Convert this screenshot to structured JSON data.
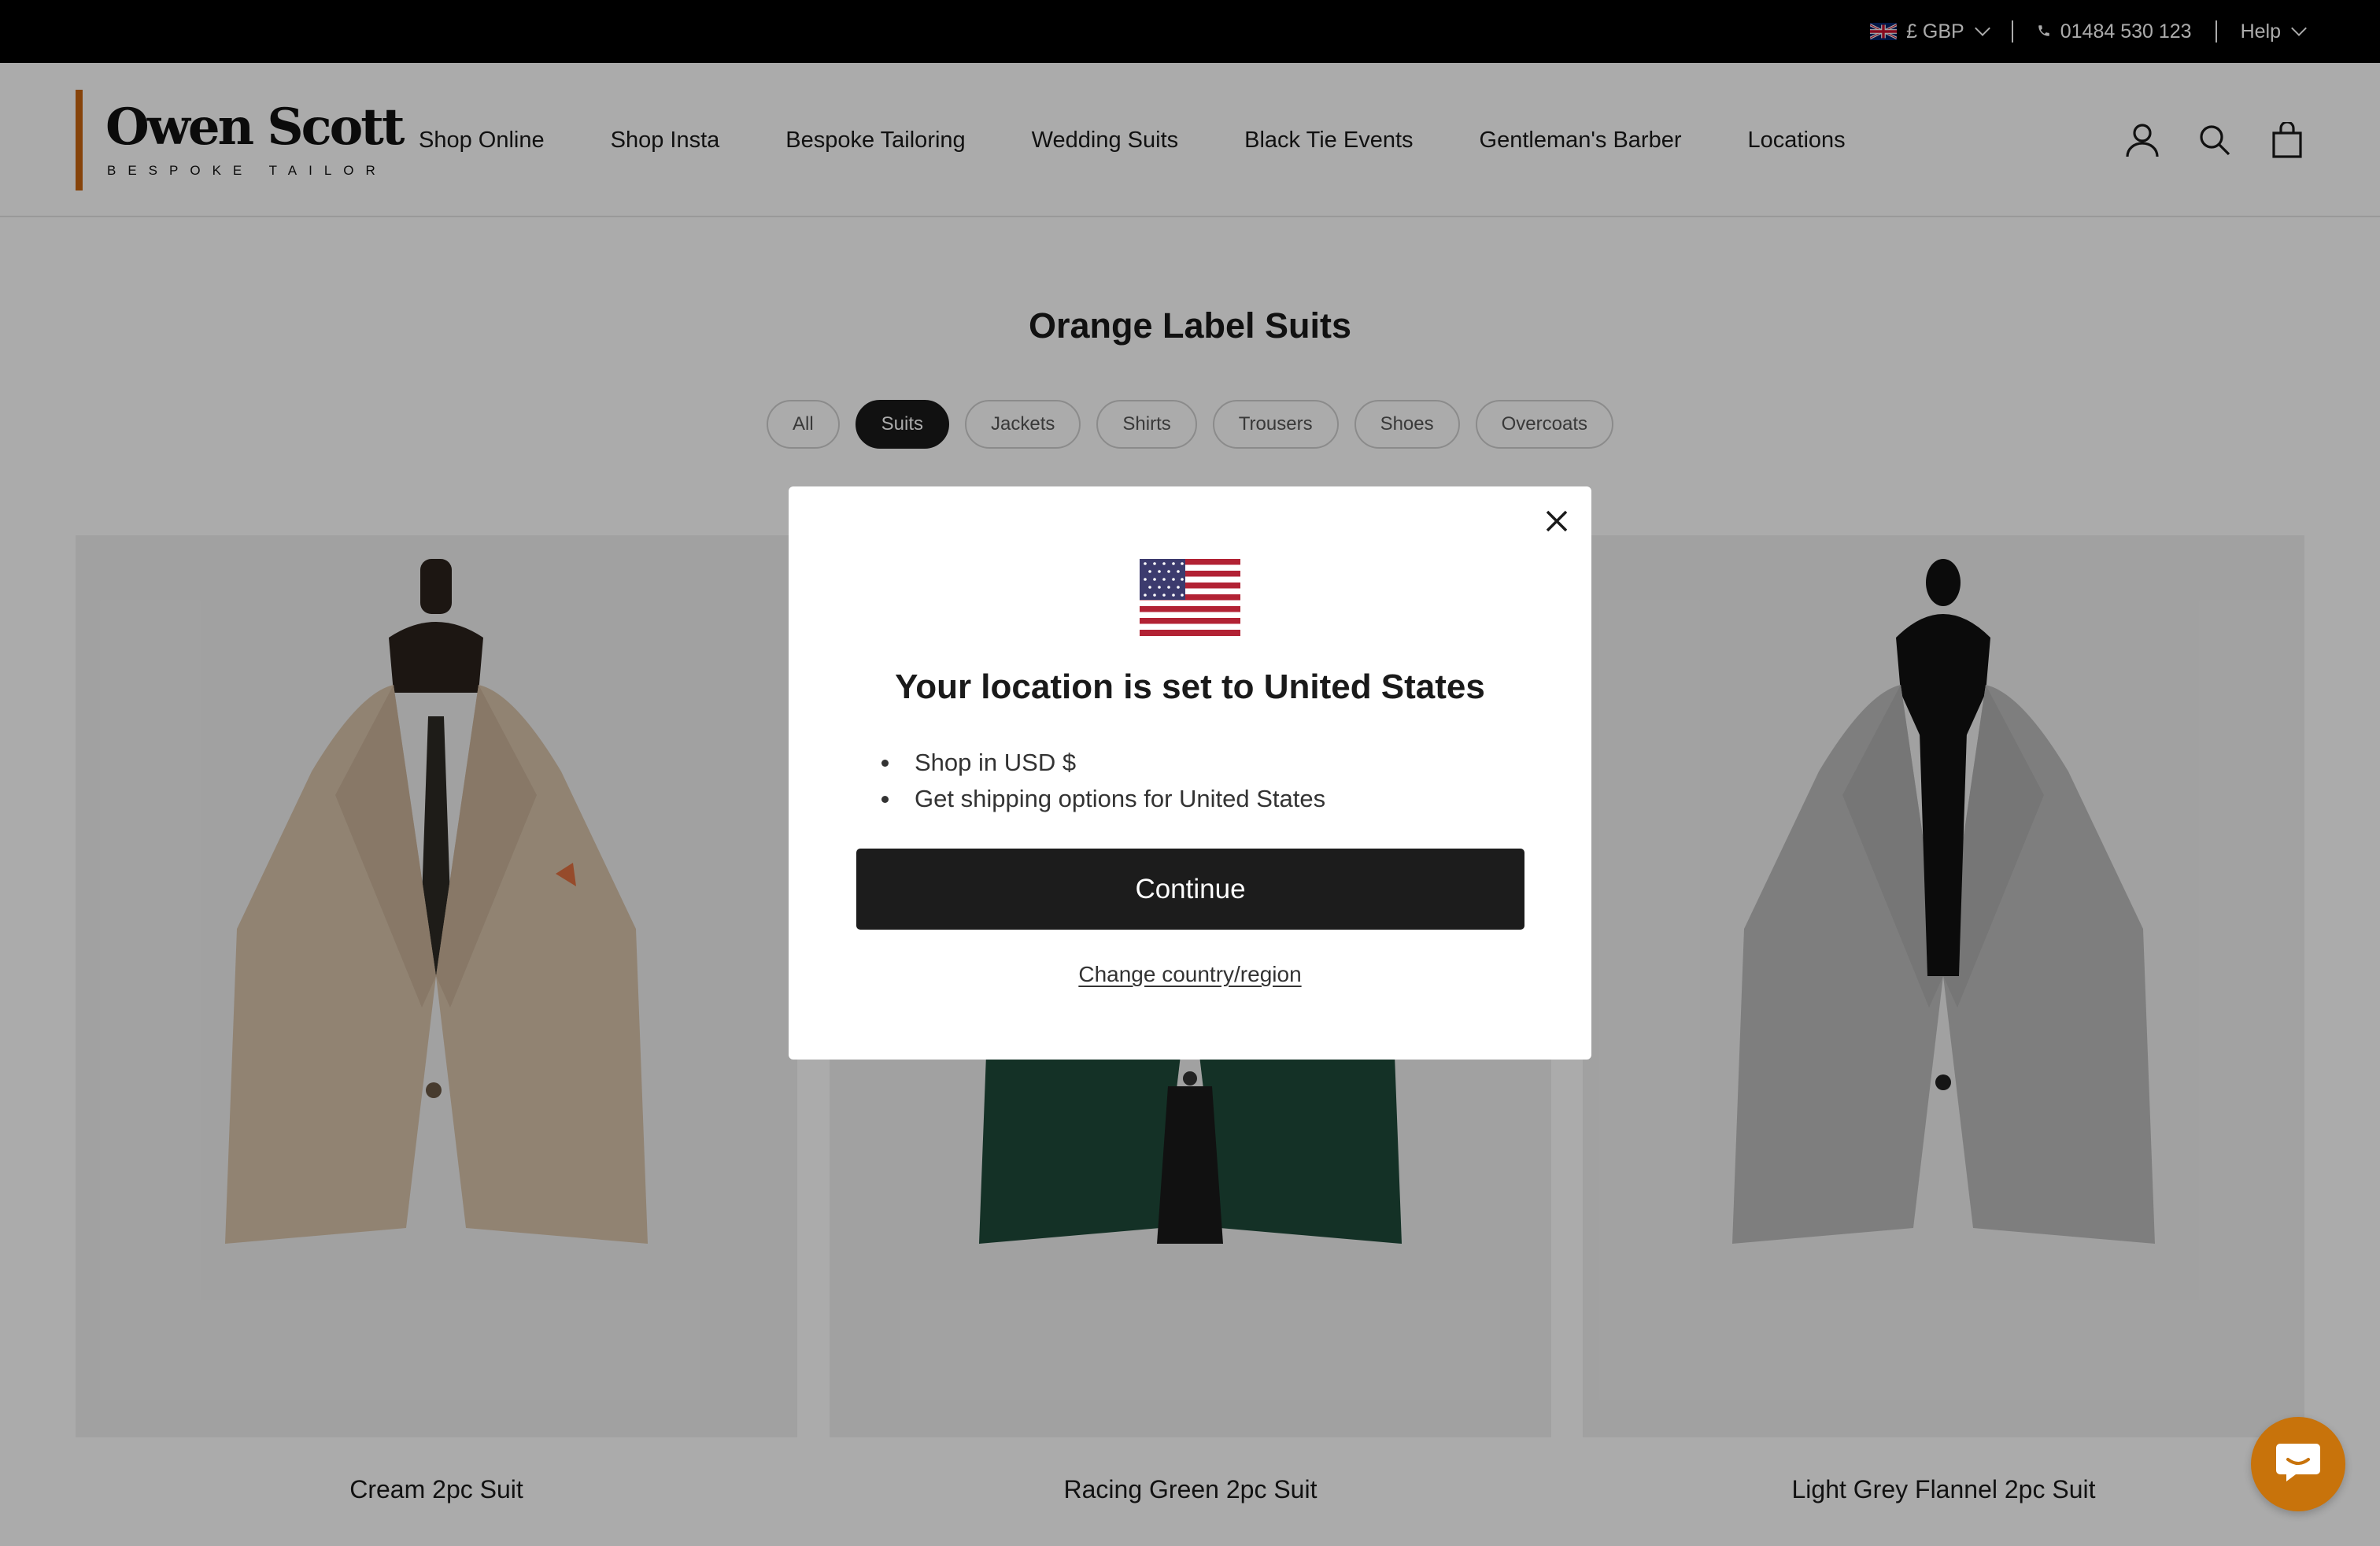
{
  "topbar": {
    "currency": "£ GBP",
    "phone": "01484 530 123",
    "help": "Help"
  },
  "header": {
    "logo_main": "Owen Scott",
    "logo_sub": "BESPOKE TAILOR",
    "nav": [
      "Shop Online",
      "Shop Insta",
      "Bespoke Tailoring",
      "Wedding Suits",
      "Black Tie Events",
      "Gentleman's Barber",
      "Locations"
    ],
    "icons": [
      "account-icon",
      "search-icon",
      "bag-icon"
    ]
  },
  "main": {
    "title": "Orange Label Suits",
    "filters": [
      {
        "label": "All",
        "active": false
      },
      {
        "label": "Suits",
        "active": true
      },
      {
        "label": "Jackets",
        "active": false
      },
      {
        "label": "Shirts",
        "active": false
      },
      {
        "label": "Trousers",
        "active": false
      },
      {
        "label": "Shoes",
        "active": false
      },
      {
        "label": "Overcoats",
        "active": false
      }
    ],
    "products": [
      {
        "name": "Cream 2pc Suit",
        "jacket_color": "#d8c3ab",
        "shirt_color": "#f0f0f0"
      },
      {
        "name": "Racing Green 2pc Suit",
        "jacket_color": "#1f4a3a",
        "shirt_color": "#1a1a1a"
      },
      {
        "name": "Light Grey Flannel 2pc Suit",
        "jacket_color": "#bdbdbd",
        "shirt_color": "#111111"
      }
    ]
  },
  "modal": {
    "heading_prefix": "Your location is set to ",
    "heading_country": "United States",
    "bullets": [
      "Shop in USD $",
      "Get shipping options for United States"
    ],
    "continue_label": "Continue",
    "change_label": "Change country/region"
  },
  "colors": {
    "accent": "#c8650f",
    "chat": "#c8730b",
    "button": "#1c1c1c"
  }
}
